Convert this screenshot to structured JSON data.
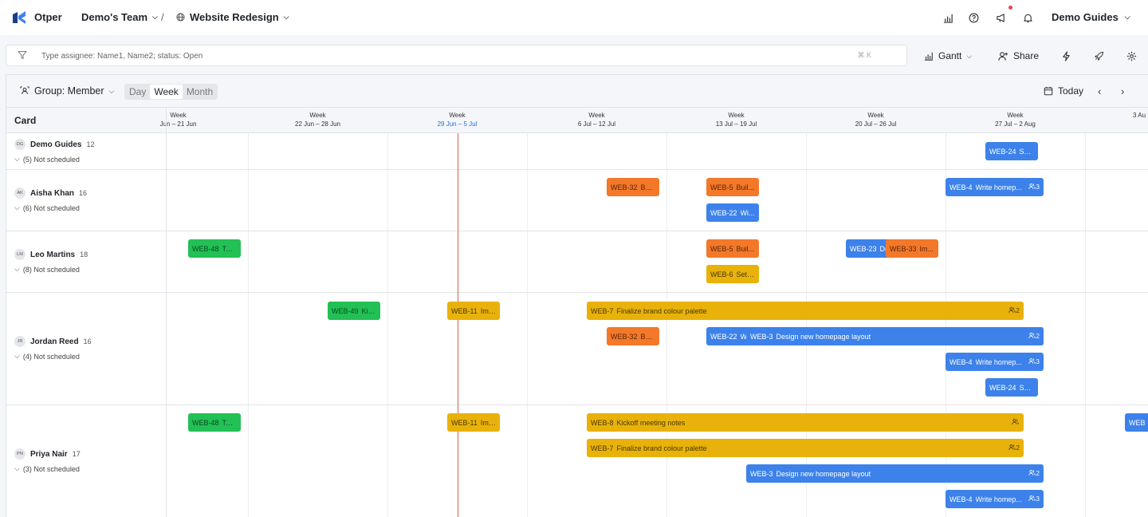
{
  "topbar": {
    "brand": "Otper",
    "team": "Demo's Team",
    "separator": "/",
    "project": "Website Redesign",
    "user": "Demo Guides",
    "icons": [
      "bar-chart-icon",
      "help-icon",
      "megaphone-icon",
      "bell-icon"
    ]
  },
  "filter": {
    "placeholder": "Type assignee: Name1, Name2; status: Open",
    "shortcut": "⌘ K"
  },
  "toolbar": {
    "view": "Gantt",
    "share": "Share",
    "icons": [
      "lightning-icon",
      "rocket-icon",
      "gear-icon"
    ]
  },
  "panel": {
    "group_label": "Group: Member",
    "scale_options": [
      "Day",
      "Week",
      "Month"
    ],
    "scale_selected": "Week",
    "today_label": "Today",
    "card_header": "Card"
  },
  "weeks": [
    {
      "label": "Week",
      "range": "Jun – 21 Jun"
    },
    {
      "label": "Week",
      "range": "22 Jun – 28 Jun"
    },
    {
      "label": "Week",
      "range": "29 Jun – 5 Jul",
      "current": true
    },
    {
      "label": "Week",
      "range": "6 Jul – 12 Jul"
    },
    {
      "label": "Week",
      "range": "13 Jul – 19 Jul"
    },
    {
      "label": "Week",
      "range": "20 Jul – 26 Jul"
    },
    {
      "label": "Week",
      "range": "27 Jul – 2 Aug"
    },
    {
      "label": "",
      "range": "3 Au"
    }
  ],
  "members": [
    {
      "initials": "DG",
      "name": "Demo Guides",
      "count": "12",
      "not_scheduled": "(5) Not scheduled"
    },
    {
      "initials": "AK",
      "name": "Aisha Khan",
      "count": "16",
      "not_scheduled": "(6) Not scheduled"
    },
    {
      "initials": "LM",
      "name": "Leo Martins",
      "count": "18",
      "not_scheduled": "(8) Not scheduled"
    },
    {
      "initials": "JR",
      "name": "Jordan Reed",
      "count": "16",
      "not_scheduled": "(4) Not scheduled"
    },
    {
      "initials": "PN",
      "name": "Priya Nair",
      "count": "17",
      "not_scheduled": "(3) Not scheduled"
    }
  ],
  "bars": [
    {
      "id": "WEB-24",
      "title": "Sel...",
      "color": "blue",
      "meta": ""
    },
    {
      "id": "WEB-32",
      "title": "Bui...",
      "color": "orange",
      "meta": ""
    },
    {
      "id": "WEB-5",
      "title": "Buil...",
      "color": "orange",
      "meta": ""
    },
    {
      "id": "WEB-4",
      "title": "Write homep...",
      "color": "blue",
      "meta": "3"
    },
    {
      "id": "WEB-22",
      "title": "Wi...",
      "color": "blue",
      "meta": ""
    },
    {
      "id": "WEB-48",
      "title": "Tec...",
      "color": "green",
      "meta": ""
    },
    {
      "id": "WEB-5",
      "title": "Buil...",
      "color": "orange",
      "meta": ""
    },
    {
      "id": "WEB-23",
      "title": "D(",
      "color": "blue",
      "meta": ""
    },
    {
      "id": "WEB-33",
      "title": "Im...",
      "color": "orange",
      "meta": ""
    },
    {
      "id": "WEB-6",
      "title": "Set ...",
      "color": "yellow",
      "meta": ""
    },
    {
      "id": "WEB-49",
      "title": "Kick...",
      "color": "green",
      "meta": ""
    },
    {
      "id": "WEB-11",
      "title": "Imp...",
      "color": "yellow",
      "meta": ""
    },
    {
      "id": "WEB-7",
      "title": "Finalize brand colour palette",
      "color": "yellow",
      "meta": "2"
    },
    {
      "id": "WEB-32",
      "title": "Bui...",
      "color": "orange",
      "meta": ""
    },
    {
      "id": "WEB-22",
      "title": "W",
      "color": "blue",
      "meta": ""
    },
    {
      "id": "WEB-3",
      "title": "Design new homepage layout",
      "color": "blue",
      "meta": "2"
    },
    {
      "id": "WEB-4",
      "title": "Write homep...",
      "color": "blue",
      "meta": "3"
    },
    {
      "id": "WEB-24",
      "title": "Sel...",
      "color": "blue",
      "meta": ""
    },
    {
      "id": "WEB-48",
      "title": "Tec...",
      "color": "green",
      "meta": ""
    },
    {
      "id": "WEB-11",
      "title": "Imp...",
      "color": "yellow",
      "meta": ""
    },
    {
      "id": "WEB-8",
      "title": "Kickoff meeting notes",
      "color": "yellow",
      "meta": " "
    },
    {
      "id": "WEB",
      "title": "",
      "color": "blue",
      "meta": ""
    },
    {
      "id": "WEB-7",
      "title": "Finalize brand colour palette",
      "color": "yellow",
      "meta": "2"
    },
    {
      "id": "WEB-3",
      "title": "Design new homepage layout",
      "color": "blue",
      "meta": "2"
    },
    {
      "id": "WEB-4",
      "title": "Write homep...",
      "color": "blue",
      "meta": "3"
    }
  ],
  "colors": {
    "blue": "#3d82eb",
    "orange": "#f3782a",
    "yellow": "#e8b20a",
    "green": "#22c055",
    "today_line": "#e0604f",
    "notification_dot": "#e5484d"
  }
}
